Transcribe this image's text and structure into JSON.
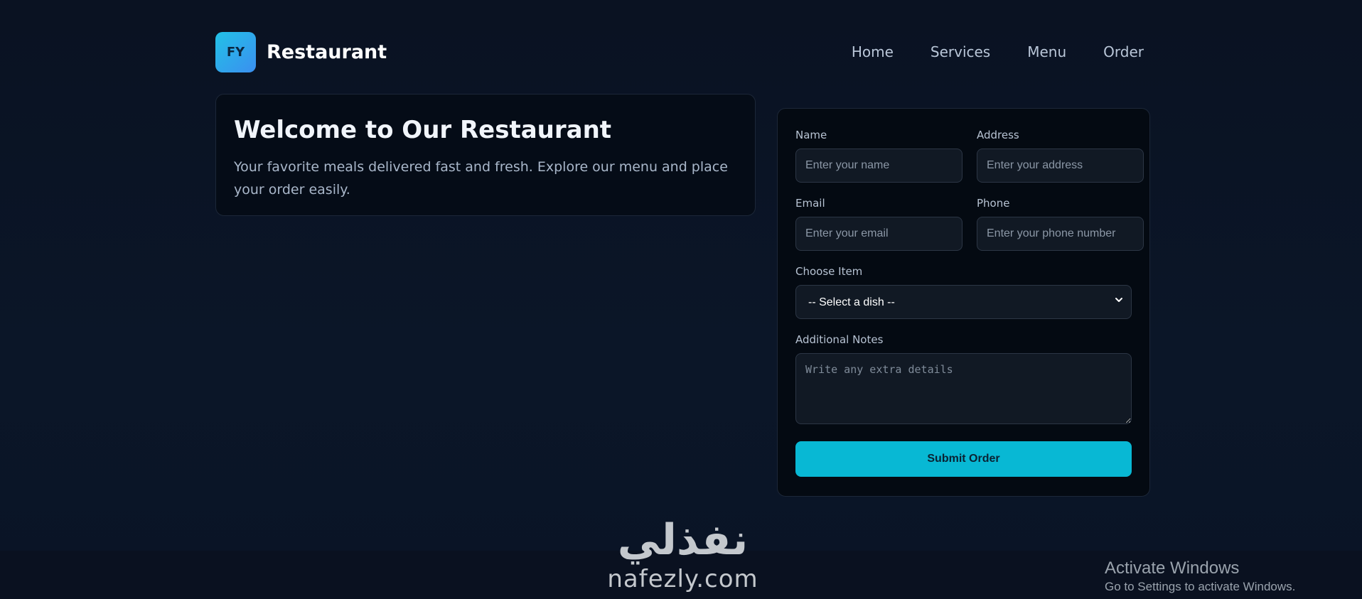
{
  "header": {
    "logo_text": "FY",
    "brand": "Restaurant",
    "nav": [
      "Home",
      "Services",
      "Menu",
      "Order"
    ]
  },
  "welcome": {
    "title": "Welcome to Our Restaurant",
    "text": "Your favorite meals delivered fast and fresh. Explore our menu and place your order easily."
  },
  "form": {
    "name_label": "Name",
    "name_placeholder": "Enter your name",
    "address_label": "Address",
    "address_placeholder": "Enter your address",
    "email_label": "Email",
    "email_placeholder": "Enter your email",
    "phone_label": "Phone",
    "phone_placeholder": "Enter your phone number",
    "item_label": "Choose Item",
    "item_selected": "-- Select a dish --",
    "notes_label": "Additional Notes",
    "notes_placeholder": "Write any extra details",
    "submit_label": "Submit Order"
  },
  "watermark": {
    "arabic": "نفذلي",
    "latin": "nafezly.com"
  },
  "activate": {
    "title": "Activate Windows",
    "subtitle": "Go to Settings to activate Windows."
  },
  "colors": {
    "accent": "#08b8d4",
    "background": "#0b1424",
    "card": "#050c17"
  }
}
